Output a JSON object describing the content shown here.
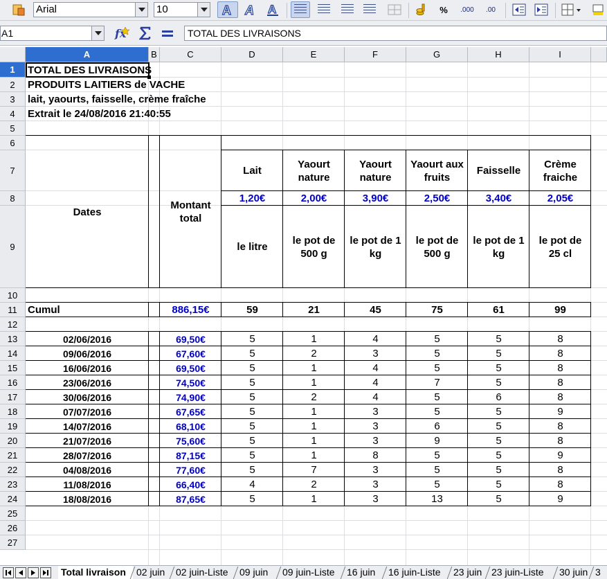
{
  "toolbar": {
    "font_name": "Arial",
    "font_size": "10",
    "percent_label": "%",
    "decimal_add_label": ".000",
    "decimal_remove_label": ".00"
  },
  "formula_bar": {
    "cell_ref": "A1",
    "content": "TOTAL DES LIVRAISONS"
  },
  "columns": [
    "A",
    "B",
    "C",
    "D",
    "E",
    "F",
    "G",
    "H",
    "I"
  ],
  "rows": [
    "1",
    "2",
    "3",
    "4",
    "5",
    "6",
    "7",
    "8",
    "9",
    "10",
    "11",
    "12",
    "13",
    "14",
    "15",
    "16",
    "17",
    "18",
    "19",
    "20",
    "21",
    "22",
    "23",
    "24",
    "25",
    "26",
    "27"
  ],
  "sheet": {
    "title_lines": [
      "TOTAL DES LIVRAISONS",
      "PRODUITS LAITIERS de VACHE",
      "lait, yaourts, faisselle, crème fraîche",
      "Extrait le 24/08/2016 21:40:55"
    ],
    "dates_header": "Dates",
    "montant_header": "Montant total",
    "products": [
      {
        "name": "Lait",
        "price": "1,20€",
        "unit": "le litre"
      },
      {
        "name": "Yaourt nature",
        "price": "2,00€",
        "unit": "le pot de 500 g"
      },
      {
        "name": "Yaourt nature",
        "price": "3,90€",
        "unit": "le pot de 1 kg"
      },
      {
        "name": "Yaourt aux fruits",
        "price": "2,50€",
        "unit": "le pot de 500 g"
      },
      {
        "name": "Faisselle",
        "price": "3,40€",
        "unit": "le pot de 1 kg"
      },
      {
        "name": "Crème fraiche",
        "price": "2,05€",
        "unit": "le pot de 25 cl"
      }
    ],
    "cumul": {
      "label": "Cumul",
      "total": "886,15€",
      "values": [
        "59",
        "21",
        "45",
        "75",
        "61",
        "99"
      ]
    },
    "deliveries": [
      {
        "date": "02/06/2016",
        "total": "69,50€",
        "qty": [
          "5",
          "1",
          "4",
          "5",
          "5",
          "8"
        ]
      },
      {
        "date": "09/06/2016",
        "total": "67,60€",
        "qty": [
          "5",
          "2",
          "3",
          "5",
          "5",
          "8"
        ]
      },
      {
        "date": "16/06/2016",
        "total": "69,50€",
        "qty": [
          "5",
          "1",
          "4",
          "5",
          "5",
          "8"
        ]
      },
      {
        "date": "23/06/2016",
        "total": "74,50€",
        "qty": [
          "5",
          "1",
          "4",
          "7",
          "5",
          "8"
        ]
      },
      {
        "date": "30/06/2016",
        "total": "74,90€",
        "qty": [
          "5",
          "2",
          "4",
          "5",
          "6",
          "8"
        ]
      },
      {
        "date": "07/07/2016",
        "total": "67,65€",
        "qty": [
          "5",
          "1",
          "3",
          "5",
          "5",
          "9"
        ]
      },
      {
        "date": "14/07/2016",
        "total": "68,10€",
        "qty": [
          "5",
          "1",
          "3",
          "6",
          "5",
          "8"
        ]
      },
      {
        "date": "21/07/2016",
        "total": "75,60€",
        "qty": [
          "5",
          "1",
          "3",
          "9",
          "5",
          "8"
        ]
      },
      {
        "date": "28/07/2016",
        "total": "87,15€",
        "qty": [
          "5",
          "1",
          "8",
          "5",
          "5",
          "9"
        ]
      },
      {
        "date": "04/08/2016",
        "total": "77,60€",
        "qty": [
          "5",
          "7",
          "3",
          "5",
          "5",
          "8"
        ]
      },
      {
        "date": "11/08/2016",
        "total": "66,40€",
        "qty": [
          "4",
          "2",
          "3",
          "5",
          "5",
          "8"
        ]
      },
      {
        "date": "18/08/2016",
        "total": "87,65€",
        "qty": [
          "5",
          "1",
          "3",
          "13",
          "5",
          "9"
        ]
      }
    ]
  },
  "sheet_tabs": [
    "Total livraison",
    "02 juin",
    "02 juin-Liste",
    "09 juin",
    "09 juin-Liste",
    "16 juin",
    "16 juin-Liste",
    "23 juin",
    "23 juin-Liste",
    "30 juin",
    "3"
  ],
  "colors": {
    "accent": "#2f6ed1",
    "value_blue": "#0000c8"
  }
}
